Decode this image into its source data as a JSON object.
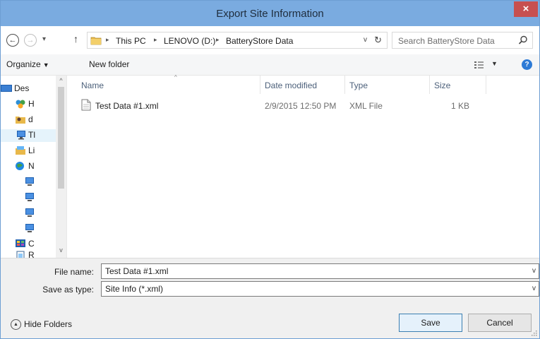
{
  "window": {
    "title": "Export Site Information",
    "close_label": "×"
  },
  "nav": {
    "back_glyph": "←",
    "forward_glyph": "→",
    "recent_glyph": "▾",
    "up_glyph": "↑",
    "breadcrumb": [
      "This PC",
      "LENOVO (D:)",
      "BatteryStore Data"
    ],
    "crumb_separator": "▸",
    "dropdown_glyph": "v",
    "refresh_glyph": "↻",
    "search_placeholder": "Search BatteryStore Data"
  },
  "toolbar": {
    "organize_label": "Organize",
    "organize_caret": "▼",
    "new_folder_label": "New folder",
    "view_caret": "▼",
    "help_label": "?"
  },
  "sidebar": {
    "items": [
      {
        "label": "Des",
        "icon": "desktop-icon"
      },
      {
        "label": "H",
        "icon": "homegroup-icon"
      },
      {
        "label": "d",
        "icon": "user-folder-icon"
      },
      {
        "label": "Tl",
        "icon": "this-pc-icon"
      },
      {
        "label": "Li",
        "icon": "libraries-icon"
      },
      {
        "label": "N",
        "icon": "network-icon"
      },
      {
        "label": "",
        "icon": "network-computer-icon"
      },
      {
        "label": "",
        "icon": "network-computer-icon"
      },
      {
        "label": "",
        "icon": "network-computer-icon"
      },
      {
        "label": "",
        "icon": "network-computer-icon"
      },
      {
        "label": "C",
        "icon": "control-panel-icon"
      },
      {
        "label": "R",
        "icon": "recycle-bin-icon"
      }
    ],
    "scroll_up": "^",
    "scroll_down": "v"
  },
  "columns": {
    "name": "Name",
    "date_modified": "Date modified",
    "type": "Type",
    "size": "Size",
    "sort_glyph": "^"
  },
  "files": [
    {
      "name": "Test Data #1.xml",
      "date_modified": "2/9/2015 12:50 PM",
      "type": "XML File",
      "size": "1 KB"
    }
  ],
  "form": {
    "file_name_label": "File name:",
    "file_name_value": "Test Data #1.xml",
    "save_as_type_label": "Save as type:",
    "save_as_type_value": "Site Info (*.xml)",
    "caret_glyph": "v"
  },
  "footer": {
    "hide_folders_label": "Hide Folders",
    "hide_folders_glyph": "▲",
    "save_label": "Save",
    "cancel_label": "Cancel"
  },
  "colors": {
    "titlebar": "#7aabe0",
    "close": "#c75050",
    "selection": "#e5f3fb",
    "folder": "#e8b84a"
  }
}
